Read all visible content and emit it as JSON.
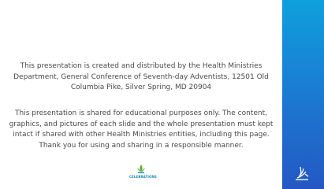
{
  "notice": {
    "paragraph_1": "This presentation is created and distributed by the Health Ministries Department, General Conference of Seventh-day Adventists, 12501 Old Columbia Pike, Silver Spring, MD 20904",
    "paragraph_2": "This presentation is shared for educational purposes only. The content, graphics, and pictures of each slide and the whole presentation must kept intact if shared with other Health Ministries entities, including this page. Thank you for using and sharing in a responsible manner."
  },
  "footer_logo": {
    "text": "CELEBRATIONS",
    "icon": "celebrations-leaf-icon"
  },
  "side_logo": {
    "icon": "adventist-flame-logo-icon"
  },
  "colors": {
    "panel_top": "#0ea0dc",
    "panel_bottom": "#2457c4",
    "text": "#4a4a4a",
    "logo_green": "#5aa832",
    "logo_blue": "#1f8bbf"
  }
}
